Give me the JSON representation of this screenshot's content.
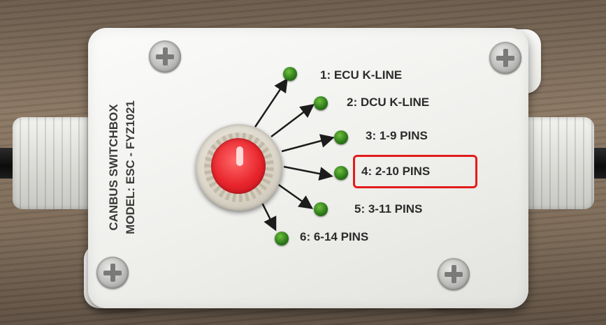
{
  "device": {
    "title": "CANBUS SWITCHBOX",
    "model": "MODEL: ESC - FYZ1021"
  },
  "positions": [
    {
      "label": "1: ECU K-LINE"
    },
    {
      "label": "2: DCU K-LINE"
    },
    {
      "label": "3: 1-9 PINS"
    },
    {
      "label": "4: 2-10 PINS"
    },
    {
      "label": "5: 3-11 PINS"
    },
    {
      "label": "6: 6-14 PINS"
    }
  ],
  "highlighted_position": "4: 2-10 PINS",
  "colors": {
    "highlight": "#e31b1b",
    "knob": "#e8252c",
    "led": "#2f7d1a",
    "enclosure": "#efefec"
  }
}
